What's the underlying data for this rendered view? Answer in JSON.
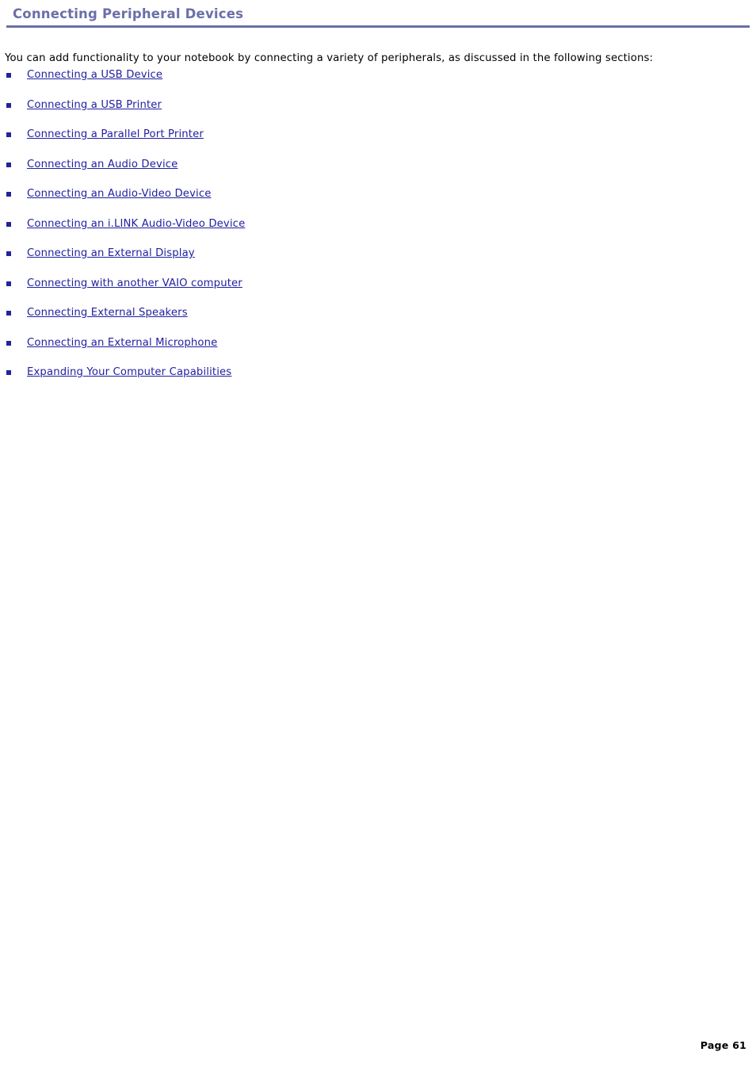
{
  "document": {
    "title": "Connecting Peripheral Devices",
    "intro": "You can add functionality to your notebook by connecting a variety of peripherals, as discussed in the following sections:",
    "links": [
      {
        "label": "Connecting a USB Device"
      },
      {
        "label": "Connecting a USB Printer"
      },
      {
        "label": "Connecting a Parallel Port Printer"
      },
      {
        "label": "Connecting an Audio Device"
      },
      {
        "label": "Connecting an Audio-Video Device"
      },
      {
        "label": "Connecting an i.LINK Audio-Video Device"
      },
      {
        "label": "Connecting an External Display"
      },
      {
        "label": "Connecting with another VAIO computer"
      },
      {
        "label": "Connecting External Speakers"
      },
      {
        "label": "Connecting an External Microphone"
      },
      {
        "label": "Expanding Your Computer Capabilities"
      }
    ],
    "footer": {
      "page_label": "Page 61"
    },
    "colors": {
      "title": "#6B6FA8",
      "link": "#1F1FA0",
      "bullet": "#23249C"
    }
  }
}
